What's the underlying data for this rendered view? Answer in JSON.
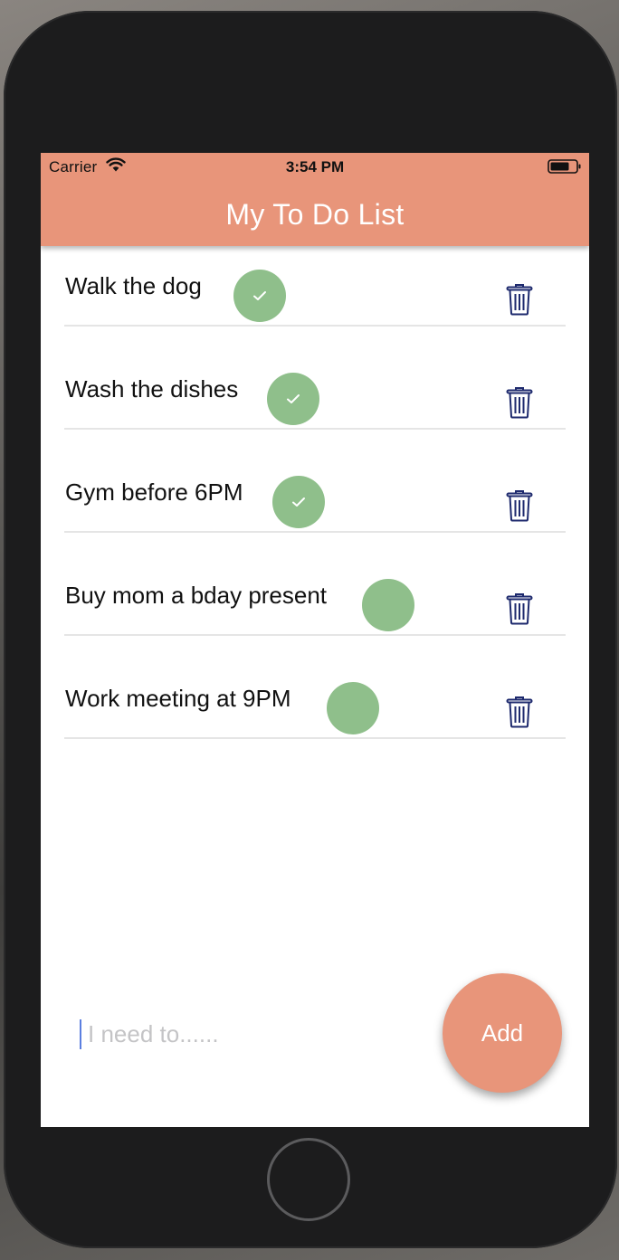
{
  "status_bar": {
    "carrier": "Carrier",
    "time": "3:54 PM"
  },
  "header": {
    "title": "My To Do List",
    "background_color": "#e8957a"
  },
  "todos": [
    {
      "text": "Walk the dog",
      "completed": true
    },
    {
      "text": "Wash the dishes",
      "completed": true
    },
    {
      "text": "Gym before 6PM",
      "completed": true
    },
    {
      "text": "Buy mom a bday present",
      "completed": false
    },
    {
      "text": "Work meeting at 9PM",
      "completed": false
    }
  ],
  "input": {
    "value": "",
    "placeholder": "I need to......"
  },
  "add_button": {
    "label": "Add"
  },
  "colors": {
    "accent": "#e8957a",
    "check": "#8fbf8b",
    "trash": "#1e2a6e"
  },
  "icons": {
    "check": "checkmark-icon",
    "delete": "trash-icon",
    "wifi": "wifi-icon",
    "battery": "battery-icon"
  }
}
